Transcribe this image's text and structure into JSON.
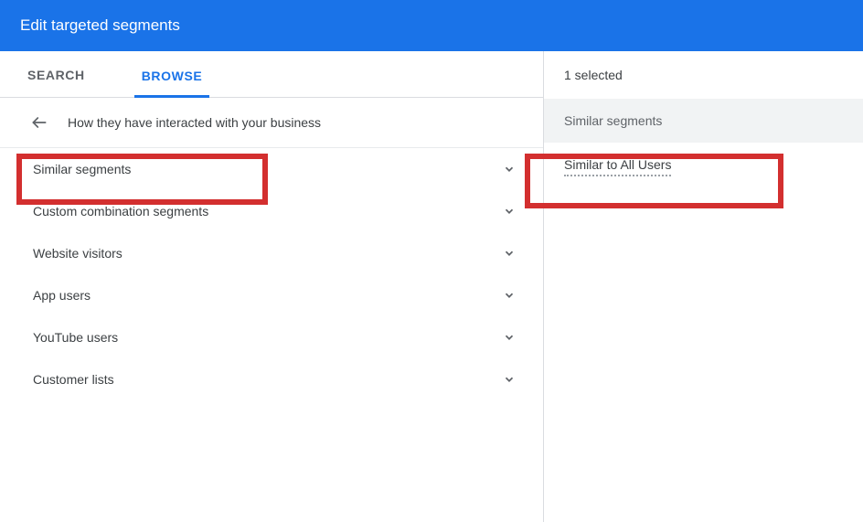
{
  "header": {
    "title": "Edit targeted segments"
  },
  "tabs": {
    "search": "SEARCH",
    "browse": "BROWSE"
  },
  "breadcrumb": {
    "label": "How they have interacted with your business"
  },
  "segments": {
    "items": [
      {
        "label": "Similar segments"
      },
      {
        "label": "Custom combination segments"
      },
      {
        "label": "Website visitors"
      },
      {
        "label": "App users"
      },
      {
        "label": "YouTube users"
      },
      {
        "label": "Customer lists"
      }
    ]
  },
  "selection": {
    "count_label": "1 selected",
    "group_title": "Similar segments",
    "item_label": "Similar to All Users"
  }
}
